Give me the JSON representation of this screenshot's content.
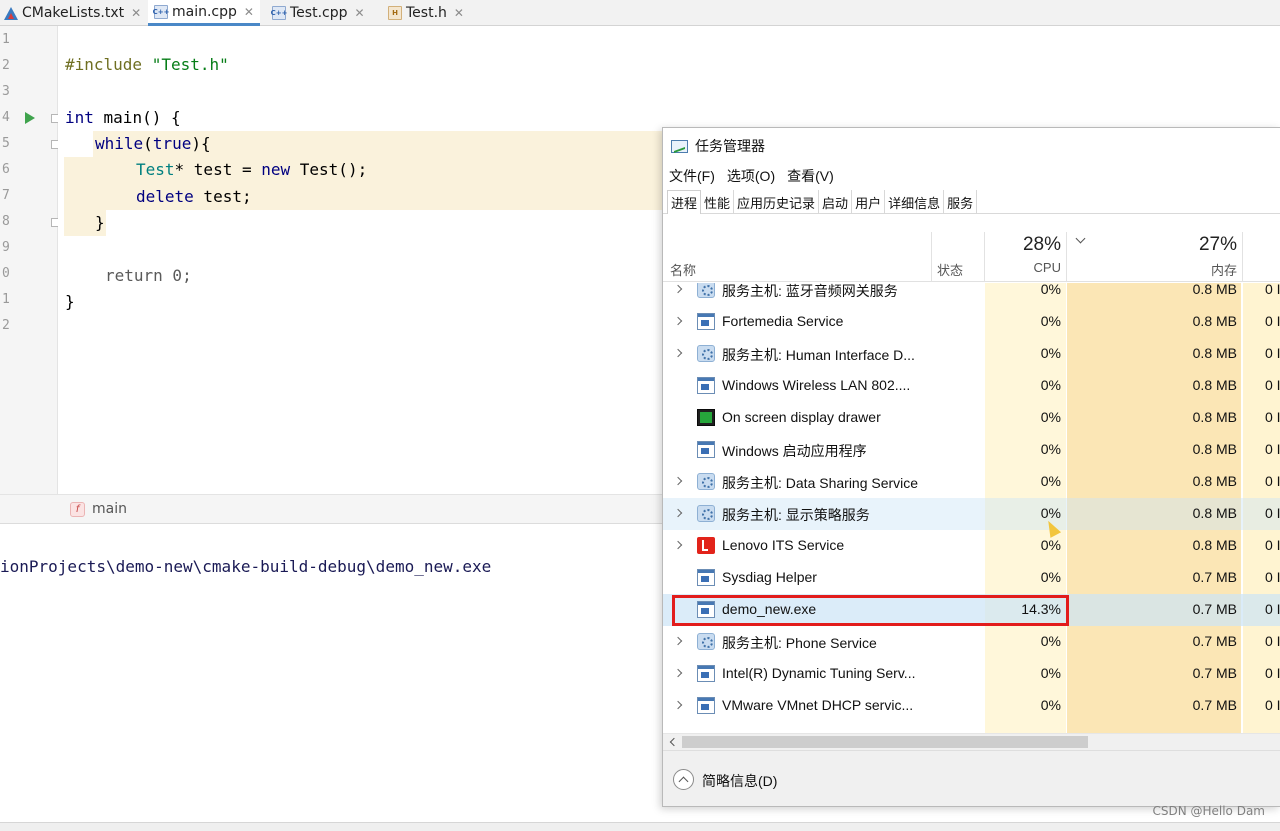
{
  "ide": {
    "tabs": [
      {
        "label": "CMakeLists.txt",
        "icon": "cmake-icon"
      },
      {
        "label": "main.cpp",
        "icon": "cpp-file-icon",
        "badge": "C++",
        "active": true
      },
      {
        "label": "Test.cpp",
        "icon": "cpp-file-icon",
        "badge": "C++"
      },
      {
        "label": "Test.h",
        "icon": "header-file-icon",
        "badge": "H"
      }
    ],
    "close_glyph": "✕",
    "line_numbers": [
      "1",
      "2",
      "3",
      "4",
      "5",
      "6",
      "7",
      "8",
      "9",
      "0",
      "1",
      "2"
    ],
    "code": {
      "l2_pp": "#include",
      "l2_str": "\"Test.h\"",
      "l4_kw": "int",
      "l4_rest": " main() {",
      "l5_kw": "while",
      "l5_p1": "(",
      "l5_kw2": "true",
      "l5_p2": "){",
      "l6_type": "Test",
      "l6_a": "* test = ",
      "l6_kw": "new",
      "l6_b": " Test();",
      "l7_kw": "delete",
      "l7_rest": " test;",
      "l8": "}",
      "l10": "return 0;",
      "l11": "}"
    },
    "breadcrumb": {
      "icon_letter": "f",
      "label": "main"
    },
    "console_path": "ionProjects\\demo-new\\cmake-build-debug\\demo_new.exe"
  },
  "task_manager": {
    "title": "任务管理器",
    "menu": [
      "文件(F)",
      "选项(O)",
      "查看(V)"
    ],
    "tabs": [
      "进程",
      "性能",
      "应用历史记录",
      "启动",
      "用户",
      "详细信息",
      "服务"
    ],
    "active_tab": "进程",
    "columns": {
      "name": "名称",
      "status": "状态",
      "cpu_pct": "28%",
      "cpu": "CPU",
      "mem_pct": "27%",
      "mem": "内存"
    },
    "rows": [
      {
        "name": "服务主机: 蓝牙音频网关服务",
        "cpu": "0%",
        "mem": "0.8 MB",
        "disk": "0 I",
        "icon": "gear-icon",
        "expandable": true
      },
      {
        "name": "Fortemedia Service",
        "cpu": "0%",
        "mem": "0.8 MB",
        "disk": "0 I",
        "icon": "window-icon",
        "expandable": true
      },
      {
        "name": "服务主机: Human Interface D...",
        "cpu": "0%",
        "mem": "0.8 MB",
        "disk": "0 I",
        "icon": "gear-icon",
        "expandable": true
      },
      {
        "name": "Windows Wireless LAN 802....",
        "cpu": "0%",
        "mem": "0.8 MB",
        "disk": "0 I",
        "icon": "window-icon",
        "expandable": false
      },
      {
        "name": "On screen display drawer",
        "cpu": "0%",
        "mem": "0.8 MB",
        "disk": "0 I",
        "icon": "fn-app-icon",
        "expandable": false
      },
      {
        "name": "Windows 启动应用程序",
        "cpu": "0%",
        "mem": "0.8 MB",
        "disk": "0 I",
        "icon": "window-icon",
        "expandable": false
      },
      {
        "name": "服务主机: Data Sharing Service",
        "cpu": "0%",
        "mem": "0.8 MB",
        "disk": "0 I",
        "icon": "gear-icon",
        "expandable": true
      },
      {
        "name": "服务主机: 显示策略服务",
        "cpu": "0%",
        "mem": "0.8 MB",
        "disk": "0 I",
        "icon": "gear-icon",
        "expandable": true,
        "hover": true
      },
      {
        "name": "Lenovo ITS Service",
        "cpu": "0%",
        "mem": "0.8 MB",
        "disk": "0 I",
        "icon": "lenovo-icon",
        "expandable": true
      },
      {
        "name": "Sysdiag Helper",
        "cpu": "0%",
        "mem": "0.7 MB",
        "disk": "0 I",
        "icon": "window-icon",
        "expandable": false
      },
      {
        "name": "demo_new.exe",
        "cpu": "14.3%",
        "mem": "0.7 MB",
        "disk": "0 I",
        "icon": "window-icon",
        "expandable": false,
        "selected": true
      },
      {
        "name": "服务主机: Phone Service",
        "cpu": "0%",
        "mem": "0.7 MB",
        "disk": "0 I",
        "icon": "gear-icon",
        "expandable": true
      },
      {
        "name": "Intel(R) Dynamic Tuning Serv...",
        "cpu": "0%",
        "mem": "0.7 MB",
        "disk": "0 I",
        "icon": "window-icon",
        "expandable": true
      },
      {
        "name": "VMware VMnet DHCP servic...",
        "cpu": "0%",
        "mem": "0.7 MB",
        "disk": "0 I",
        "icon": "window-icon",
        "expandable": true
      }
    ],
    "footer": "简略信息(D)"
  },
  "watermark": "CSDN @Hello Dam",
  "colors": {
    "cpu_column": "#fff7da",
    "mem_column": "#fbe6b5",
    "selection_outline": "#e21c1c",
    "code_highlight": "#faf2dc"
  }
}
